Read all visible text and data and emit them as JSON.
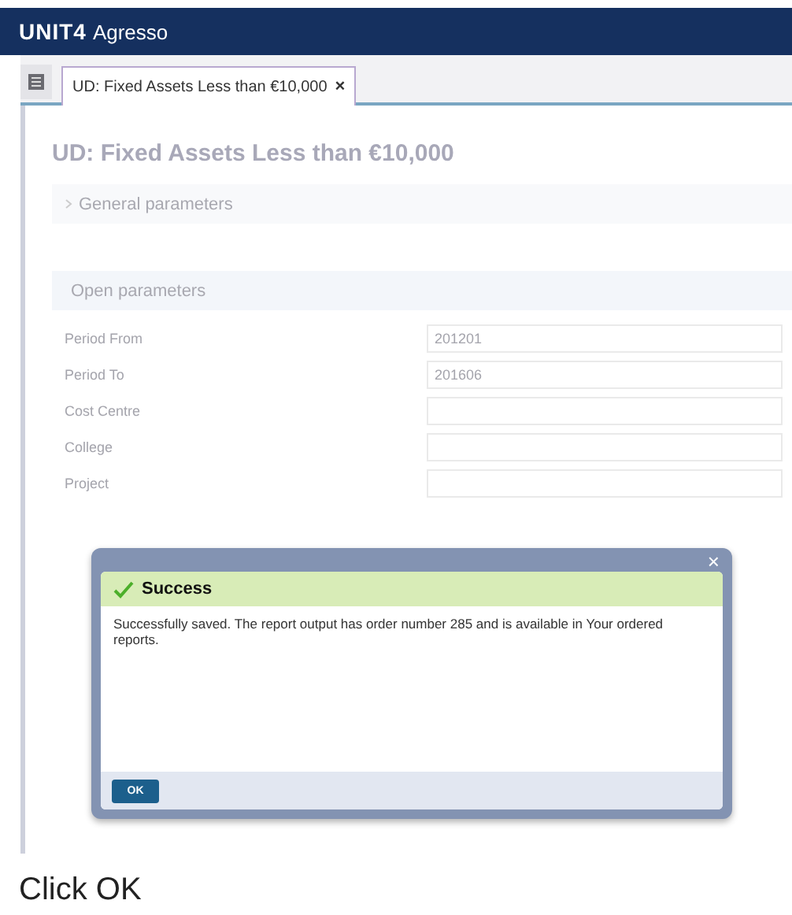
{
  "app": {
    "brand": "UNIT4",
    "product": "Agresso"
  },
  "tabs": [
    {
      "label": "UD: Fixed Assets Less than €10,000",
      "selected": true,
      "close": "×"
    }
  ],
  "page": {
    "title": "UD: Fixed Assets Less than €10,000"
  },
  "general_parameters": {
    "label": "General parameters",
    "expanded": false
  },
  "open_parameters": {
    "label": "Open parameters",
    "fields": [
      {
        "label": "Period From",
        "value": "201201"
      },
      {
        "label": "Period To",
        "value": "201606"
      },
      {
        "label": "Cost Centre"
      },
      {
        "label": "College"
      },
      {
        "label": "Project"
      }
    ]
  },
  "dialog": {
    "close": "×",
    "title": "Success",
    "message": "Successfully saved. The report output has order number 285 and is available in Your ordered reports.",
    "button": "OK"
  },
  "caption": "Click OK"
}
